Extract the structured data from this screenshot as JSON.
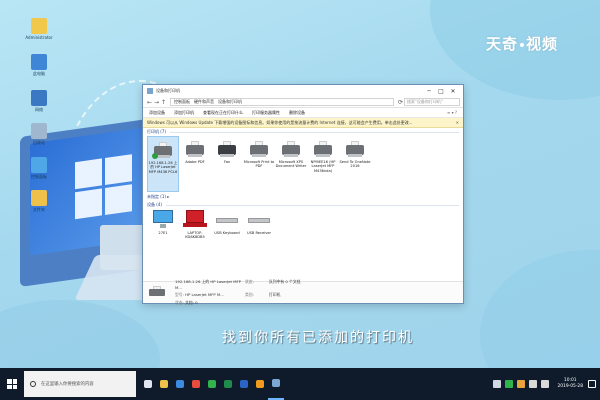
{
  "watermark": {
    "part1": "天奇",
    "part2": "视频"
  },
  "caption": "找到你所有已添加的打印机",
  "desktop_icons": [
    {
      "label": "Administrator",
      "color": "#f2c84b"
    },
    {
      "label": "此电脑",
      "color": "#3f86d6"
    },
    {
      "label": "网络",
      "color": "#3a78c4"
    },
    {
      "label": "回收站",
      "color": "#9fb8d0"
    },
    {
      "label": "控制面板",
      "color": "#4fa7e8"
    },
    {
      "label": "文件夹",
      "color": "#f0c14a"
    }
  ],
  "window": {
    "title": "设备和打印机",
    "controls": {
      "minimize": "─",
      "maximize": "□",
      "close": "✕"
    },
    "address": {
      "back": "←",
      "forward": "→",
      "up": "↑",
      "path": [
        "控制面板",
        "硬件和声音",
        "设备和打印机"
      ],
      "refresh": "⟳",
      "search_placeholder": "搜索\"设备和打印机\""
    },
    "toolbar": [
      "添加设备",
      "添加打印机",
      "查看现在正在打印什么",
      "打印服务器属性",
      "删除设备"
    ],
    "toolbar_right": "≡ ▾  ?",
    "infobar": "Windows 可以从 Windows Update 下载增强的设备图标和信息。如果你使用的是按流量计费的 Internet 连接，这可能会产生费用。单击此处更改...",
    "infobar_close": "✕",
    "printers_header": "打印机 (7)",
    "printers": [
      {
        "name": "192.168.1.26 上的 HP LaserJet MFP M436 PCL6",
        "default": true
      },
      {
        "name": "Adobe PDF",
        "default": false
      },
      {
        "name": "Fax",
        "default": false
      },
      {
        "name": "Microsoft Print to PDF",
        "default": false
      },
      {
        "name": "Microsoft XPS Document Writer",
        "default": false
      },
      {
        "name": "NPI9EE16 (HP LaserJet MFP M436nda)",
        "default": false
      },
      {
        "name": "Send To OneNote 2016",
        "default": false
      }
    ],
    "unspecified_header": "未指定 (1) ▸",
    "devices_header": "设备 (4)",
    "devices": [
      {
        "name": "27E1",
        "kind": "monitor"
      },
      {
        "name": "LAPTOP-KD8K8DB5",
        "kind": "laptop"
      },
      {
        "name": "USB Keyboard",
        "kind": "keyboard"
      },
      {
        "name": "USB Receiver",
        "kind": "keyboard"
      }
    ],
    "status": {
      "device_name": "192.168.1.26 上的 HP LaserJet MFP M...",
      "state_label": "状态:",
      "state_value": "文档: 0",
      "model_label": "型号:",
      "model_value": "HP LaserJet MFP M...",
      "category_label": "类别:",
      "category_value": "打印机",
      "status_label": "状态:",
      "status_value": "队列中有 0 个文档"
    }
  },
  "taskbar": {
    "search_placeholder": "在这里输入你要搜索的内容",
    "apps": [
      {
        "name": "task-view",
        "color": "#dfe6ee"
      },
      {
        "name": "file-explorer",
        "color": "#f0c14a"
      },
      {
        "name": "edge",
        "color": "#3c8be0"
      },
      {
        "name": "chrome",
        "color": "#e74c3c"
      },
      {
        "name": "wechat",
        "color": "#2fb34a"
      },
      {
        "name": "excel",
        "color": "#1f8b4c"
      },
      {
        "name": "word",
        "color": "#2b64c9"
      },
      {
        "name": "media",
        "color": "#f39a1e"
      },
      {
        "name": "devices-printers",
        "color": "#7ca7d4",
        "active": true
      }
    ],
    "clock_time": "10:01",
    "clock_date": "2019-05-28"
  }
}
